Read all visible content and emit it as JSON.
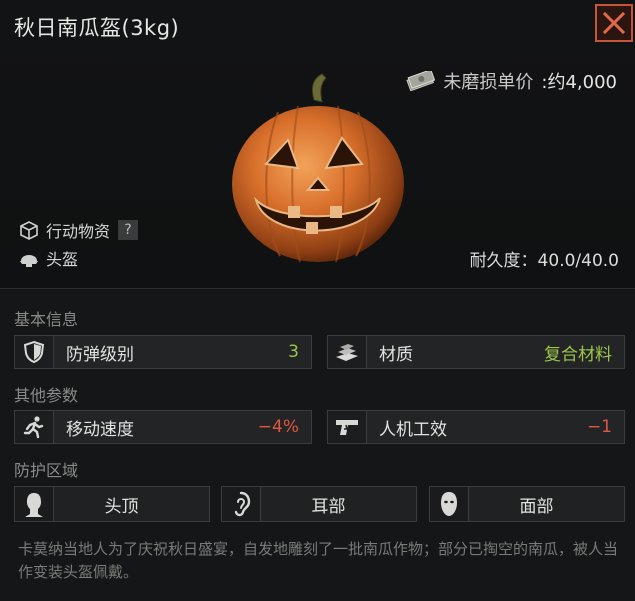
{
  "header": {
    "title": "秋日南瓜盔(3kg)"
  },
  "price": {
    "label": "未磨损单价",
    "value": ":约4,000"
  },
  "tags": [
    {
      "label": "行动物资",
      "help": "?"
    },
    {
      "label": "头盔"
    }
  ],
  "durability": "耐久度：40.0/40.0",
  "sections": {
    "basic": "基本信息",
    "other": "其他参数",
    "protect": "防护区域"
  },
  "basic_stats": [
    {
      "name": "防弹级别",
      "value": "3"
    },
    {
      "name": "材质",
      "value": "复合材料"
    }
  ],
  "other_stats": [
    {
      "name": "移动速度",
      "value": "−4%"
    },
    {
      "name": "人机工效",
      "value": "−1"
    }
  ],
  "zones": [
    {
      "name": "头顶"
    },
    {
      "name": "耳部"
    },
    {
      "name": "面部"
    }
  ],
  "description": "卡莫纳当地人为了庆祝秋日盛宴，自发地雕刻了一批南瓜作物；部分已掏空的南瓜，被人当作变装头盔佩戴。",
  "colors": {
    "positive": "#9bc64b",
    "negative": "#e0573f",
    "accent": "#c8553a"
  },
  "icons": [
    "close-icon",
    "money-icon",
    "box-icon",
    "helmet-icon",
    "shield-icon",
    "material-icon",
    "running-icon",
    "pistol-icon",
    "head-top-icon",
    "ear-icon",
    "face-icon"
  ]
}
